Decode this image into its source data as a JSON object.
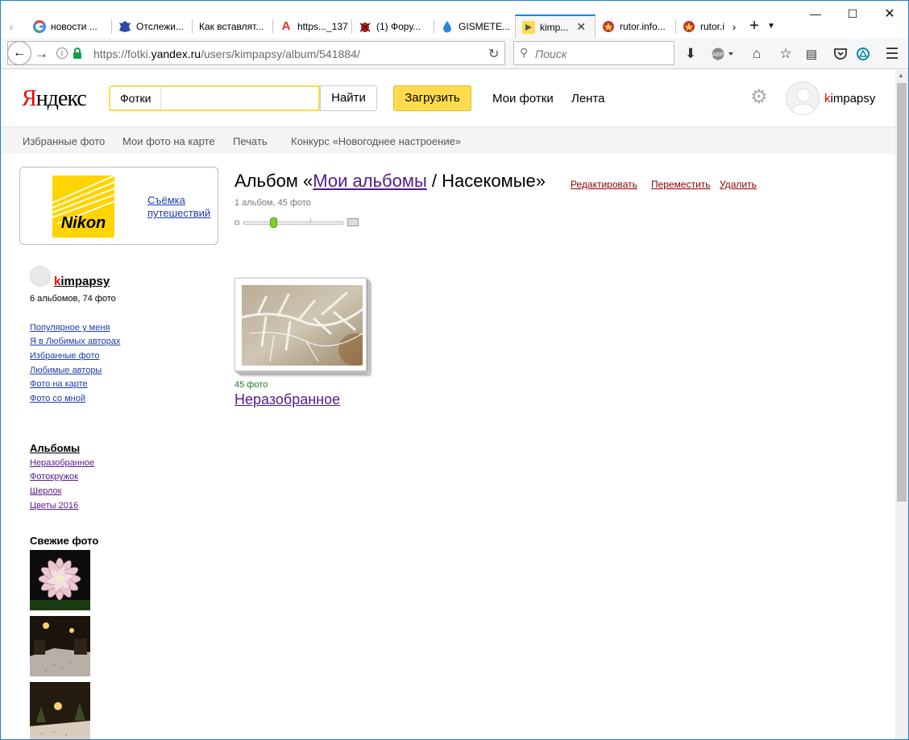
{
  "tabs": [
    {
      "label": "новости ...",
      "icon": "google-icon"
    },
    {
      "label": "Отслежи...",
      "icon": "emblem-icon"
    },
    {
      "label": "Как вставлят...",
      "icon": ""
    },
    {
      "label": "https..._137",
      "icon": "letter-a-icon"
    },
    {
      "label": "(1) Фору...",
      "icon": "bug-icon"
    },
    {
      "label": "GISMETE...",
      "icon": "drop-icon"
    },
    {
      "label": "kimp...",
      "icon": "yandex-fotki-icon",
      "active": true
    },
    {
      "label": "rutor.info...",
      "icon": "rutor-icon"
    },
    {
      "label": "rutor.i",
      "icon": "rutor-icon"
    }
  ],
  "url": {
    "prefix": "https://fotki.",
    "host": "yandex.ru",
    "path": "/users/kimpapsy/album/541884/"
  },
  "search_placeholder": "Поиск",
  "header": {
    "logo_first": "Я",
    "logo_rest": "ндекс",
    "search_tag": "Фотки",
    "find_label": "Найти",
    "upload_label": "Загрузить",
    "my_photos": "Мои фотки",
    "feed": "Лента",
    "user_first": "k",
    "user_rest": "impapsy"
  },
  "subnav": [
    "Избранные фото",
    "Мои фото на карте",
    "Печать",
    "Конкурс «Новогоднее настроение»"
  ],
  "ad": {
    "brand": "Nikon",
    "link_line1": "Съёмка",
    "link_line2": "путешествий"
  },
  "user": {
    "name_first": "k",
    "name_rest": "impapsy",
    "counts": "6 альбомов, 74 фото"
  },
  "user_links": [
    "Популярное у меня",
    "Я в Любимых авторах",
    "Избранные фото",
    "Любимые авторы",
    "Фото на карте",
    "Фото со мной"
  ],
  "albums": {
    "heading": "Альбомы",
    "items": [
      "Неразобранное",
      "Фотокружок",
      "Шерлок",
      "Цветы 2016"
    ]
  },
  "fresh_heading": "Свежие фото",
  "album": {
    "title_prefix": "Альбом «",
    "title_link": "Мои альбомы",
    "title_suffix": " / Насекомые»",
    "edit": "Редактировать",
    "move": "Переместить",
    "delete": "Удалить",
    "count": "1 альбом, 45 фото",
    "slider_level": 0.3
  },
  "subalbum": {
    "photo_count": "45 фото",
    "name": "Неразобранное"
  },
  "colors": {
    "accent": "#ffdb4d",
    "visited": "#551a8b",
    "link": "#1c3cad",
    "logo_red": "#ee0000"
  }
}
